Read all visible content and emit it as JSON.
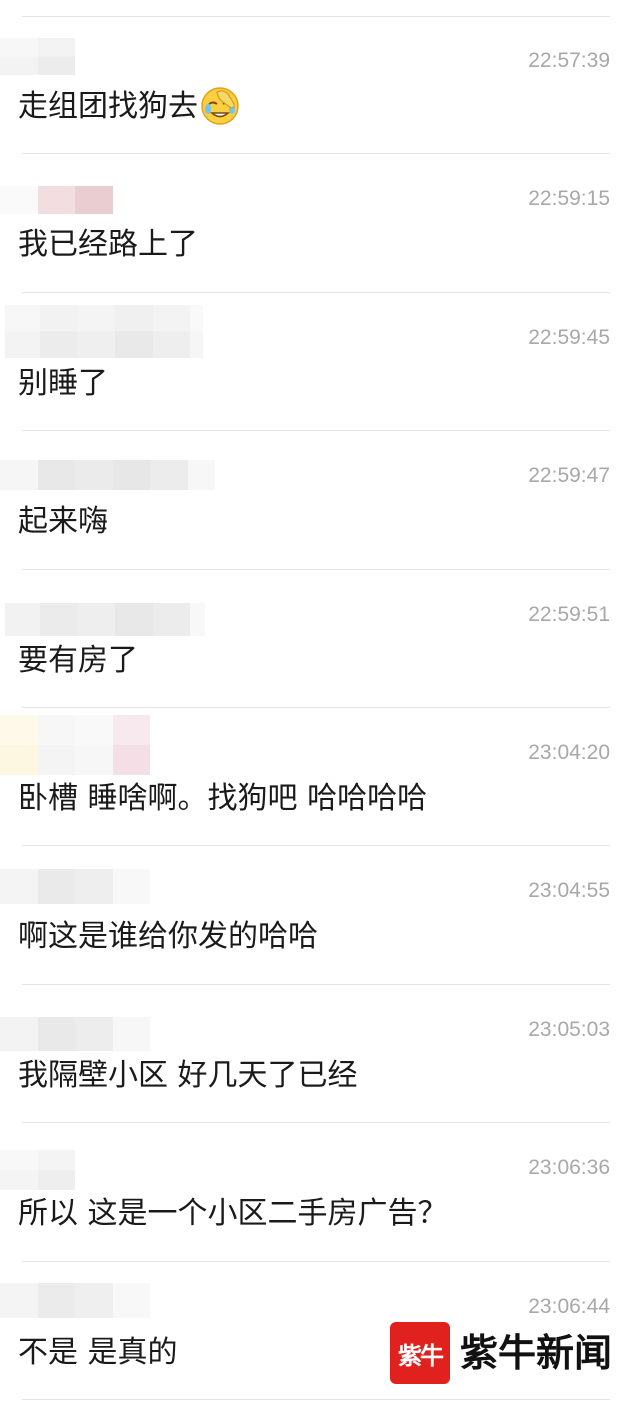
{
  "messages": [
    {
      "time": "22:57:39",
      "text": "走组团找狗去",
      "emoji": "facepalm-emoji-icon"
    },
    {
      "time": "22:59:15",
      "text": "我已经路上了"
    },
    {
      "time": "22:59:45",
      "text": "别睡了"
    },
    {
      "time": "22:59:47",
      "text": "起来嗨"
    },
    {
      "time": "22:59:51",
      "text": "要有房了"
    },
    {
      "time": "23:04:20",
      "text": "卧槽 睡啥啊。找狗吧 哈哈哈哈"
    },
    {
      "time": "23:04:55",
      "text": "啊这是谁给你发的哈哈"
    },
    {
      "time": "23:05:03",
      "text": "我隔壁小区 好几天了已经"
    },
    {
      "time": "23:06:36",
      "text": "所以 这是一个小区二手房广告？"
    },
    {
      "time": "23:06:44",
      "text": "不是 是真的"
    }
  ],
  "watermark": {
    "logo_text": "紫牛",
    "name": "紫牛新闻"
  },
  "colors": {
    "text": "#1a1a1a",
    "timestamp": "#a8a8a8",
    "divider": "#e6e6e6",
    "brand_red": "#e0211d"
  }
}
